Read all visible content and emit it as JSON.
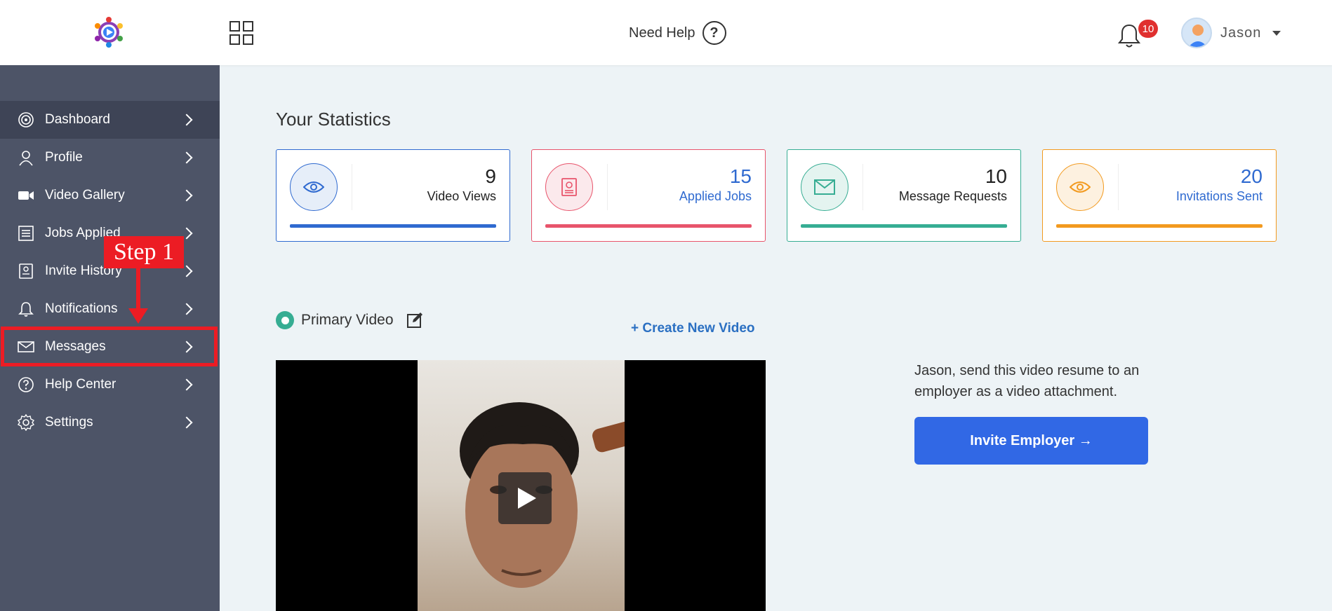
{
  "header": {
    "help_label": "Need Help",
    "help_icon_glyph": "?",
    "notification_count": "10",
    "user_name": "Jason"
  },
  "sidebar": {
    "items": [
      {
        "label": "Dashboard",
        "icon": "dashboard-icon",
        "active": true
      },
      {
        "label": "Profile",
        "icon": "user-icon"
      },
      {
        "label": "Video Gallery",
        "icon": "video-camera-icon"
      },
      {
        "label": "Jobs Applied",
        "icon": "list-icon"
      },
      {
        "label": "Invite History",
        "icon": "invite-history-icon"
      },
      {
        "label": "Notifications",
        "icon": "bell-icon"
      },
      {
        "label": "Messages",
        "icon": "envelope-icon"
      },
      {
        "label": "Help Center",
        "icon": "question-circle-icon"
      },
      {
        "label": "Settings",
        "icon": "gear-icon"
      }
    ]
  },
  "annotation": {
    "step_label": "Step 1"
  },
  "stats": {
    "title": "Your Statistics",
    "cards": [
      {
        "value": "9",
        "label": "Video Views",
        "icon": "eye-icon",
        "color": "#2f6ad0"
      },
      {
        "value": "15",
        "label": "Applied Jobs",
        "icon": "applied-jobs-icon",
        "color": "#e8546b"
      },
      {
        "value": "10",
        "label": "Message Requests",
        "icon": "envelope-icon",
        "color": "#36ad93"
      },
      {
        "value": "20",
        "label": "Invitations Sent",
        "icon": "eye-icon",
        "color": "#f29a1f"
      }
    ]
  },
  "video_section": {
    "primary_label": "Primary Video",
    "create_link": "+ Create New Video",
    "invite_text": "Jason, send this video resume to an employer as a video attachment.",
    "invite_button": "Invite Employer →"
  },
  "colors": {
    "sidebar_bg": "#4d5467",
    "sidebar_active_bg": "#3e4456",
    "page_bg": "#edf3f6",
    "annotation_red": "#ec1c24",
    "primary_button": "#3168e5",
    "link_blue": "#2a6fc2"
  }
}
